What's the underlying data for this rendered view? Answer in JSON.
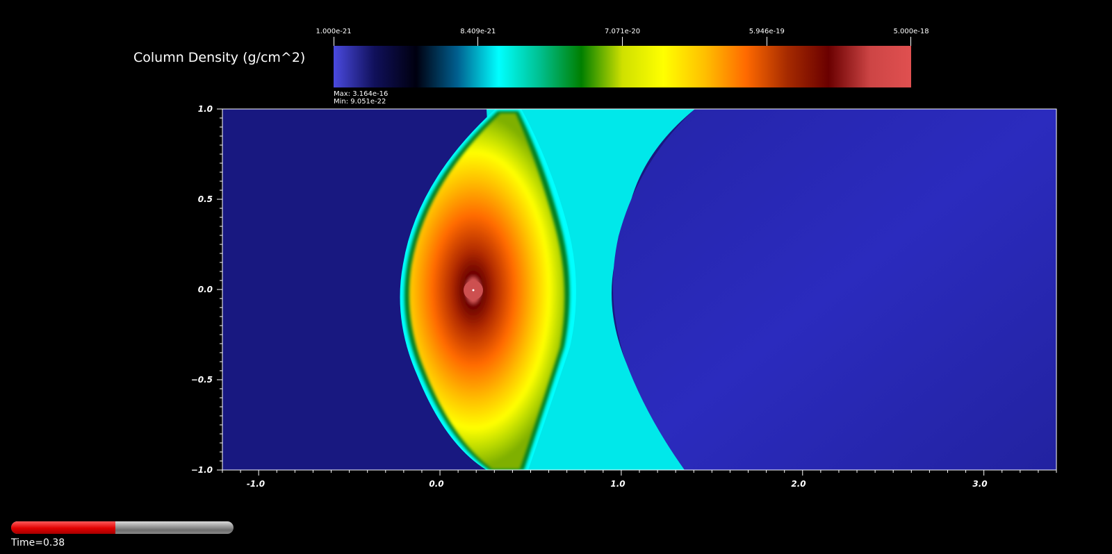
{
  "colorbar": {
    "title": "Column Density (g/cm^2)",
    "ticks": [
      "1.000e-21",
      "8.409e-21",
      "7.071e-20",
      "5.946e-19",
      "5.000e-18"
    ],
    "max_label": "Max:  3.164e-16",
    "min_label": "Min:  9.051e-22",
    "colormap": [
      "#4a4adf",
      "#10105a",
      "#00000f",
      "#005f8f",
      "#00ffff",
      "#00c090",
      "#007f00",
      "#cfe000",
      "#ffff00",
      "#ffbf00",
      "#ff6a00",
      "#a52a00",
      "#6a0000",
      "#cd4545",
      "#e05050"
    ]
  },
  "time": {
    "label": "Time=0.38",
    "progress": 0.47
  },
  "chart_data": {
    "type": "heatmap",
    "title": "",
    "xlabel": "",
    "ylabel": "",
    "xlim": [
      -1.2,
      3.4
    ],
    "ylim": [
      -1.0,
      1.0
    ],
    "xticks": [
      "-1.0",
      "0.0",
      "1.0",
      "2.0",
      "3.0"
    ],
    "xtick_values": [
      -1.0,
      0.0,
      1.0,
      2.0,
      3.0
    ],
    "yticks": [
      "1.0",
      "0.5",
      "0.0",
      "−0.5",
      "−1.0"
    ],
    "ytick_values": [
      1.0,
      0.5,
      0.0,
      -0.5,
      -1.0
    ],
    "color_scale": "log",
    "color_range": [
      1e-21,
      5e-18
    ],
    "features": {
      "core_center": [
        0.2,
        0.0
      ],
      "background_color": "#181880",
      "far_region_color": "#2a2ab8",
      "shell_colors": [
        "#00ffff",
        "#00a050",
        "#9fcf00",
        "#ffff00",
        "#ffbf00",
        "#ff6a00",
        "#8b0000",
        "#cd5050"
      ]
    }
  }
}
